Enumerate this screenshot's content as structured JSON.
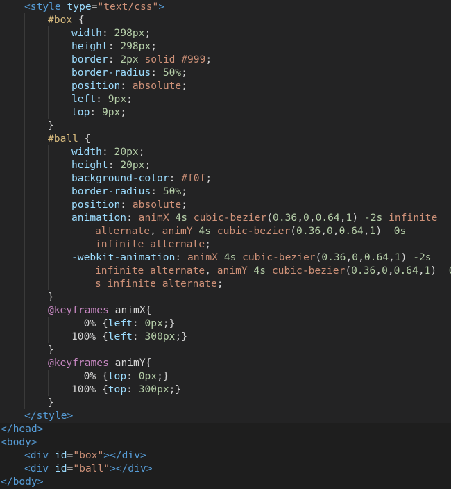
{
  "editor": {
    "language": "html",
    "lines": [
      {
        "indent": 1,
        "text": "<style type=\"text/css\">"
      },
      {
        "indent": 2,
        "text": "#box {"
      },
      {
        "indent": 3,
        "text": "width: 298px;"
      },
      {
        "indent": 3,
        "text": "height: 298px;"
      },
      {
        "indent": 3,
        "text": "border: 2px solid #999;"
      },
      {
        "indent": 3,
        "text": "border-radius: 50%;"
      },
      {
        "indent": 3,
        "text": "position: absolute;"
      },
      {
        "indent": 3,
        "text": "left: 9px;"
      },
      {
        "indent": 3,
        "text": "top: 9px;"
      },
      {
        "indent": 2,
        "text": "}"
      },
      {
        "indent": 2,
        "text": "#ball {"
      },
      {
        "indent": 3,
        "text": "width: 20px;"
      },
      {
        "indent": 3,
        "text": "height: 20px;"
      },
      {
        "indent": 3,
        "text": "background-color: #f0f;"
      },
      {
        "indent": 3,
        "text": "border-radius: 50%;"
      },
      {
        "indent": 3,
        "text": "position: absolute;"
      },
      {
        "indent": 3,
        "text": "animation: animX 4s cubic-bezier(0.36,0,0.64,1) -2s infinite"
      },
      {
        "indent": 4,
        "text": "alternate, animY 4s cubic-bezier(0.36,0,0.64,1)  0s"
      },
      {
        "indent": 4,
        "text": "infinite alternate;"
      },
      {
        "indent": 3,
        "text": "-webkit-animation: animX 4s cubic-bezier(0.36,0,0.64,1) -2s"
      },
      {
        "indent": 4,
        "text": "infinite alternate, animY 4s cubic-bezier(0.36,0,0.64,1)  0"
      },
      {
        "indent": 4,
        "text": "s infinite alternate;"
      },
      {
        "indent": 2,
        "text": "}"
      },
      {
        "indent": 2,
        "text": "@keyframes animX{"
      },
      {
        "indent": 3,
        "text": "  0% {left: 0px;}"
      },
      {
        "indent": 3,
        "text": "100% {left: 300px;}"
      },
      {
        "indent": 2,
        "text": "}"
      },
      {
        "indent": 2,
        "text": "@keyframes animY{"
      },
      {
        "indent": 3,
        "text": "  0% {top: 0px;}"
      },
      {
        "indent": 3,
        "text": "100% {top: 300px;}"
      },
      {
        "indent": 2,
        "text": "}"
      },
      {
        "indent": 1,
        "text": "</style>"
      },
      {
        "indent": 0,
        "text": "</head>"
      },
      {
        "indent": 0,
        "text": "<body>"
      },
      {
        "indent": 1,
        "text": "<div id=\"box\"></div>"
      },
      {
        "indent": 1,
        "text": "<div id=\"ball\"></div>"
      },
      {
        "indent": 0,
        "text": "</body>"
      }
    ]
  },
  "colors": {
    "background": "#1e1e1e",
    "tag": "#569cd6",
    "attribute": "#9cdcfe",
    "string": "#ce9178",
    "selector": "#d7ba7d",
    "number": "#b5cea8",
    "at_rule": "#c586c0"
  }
}
